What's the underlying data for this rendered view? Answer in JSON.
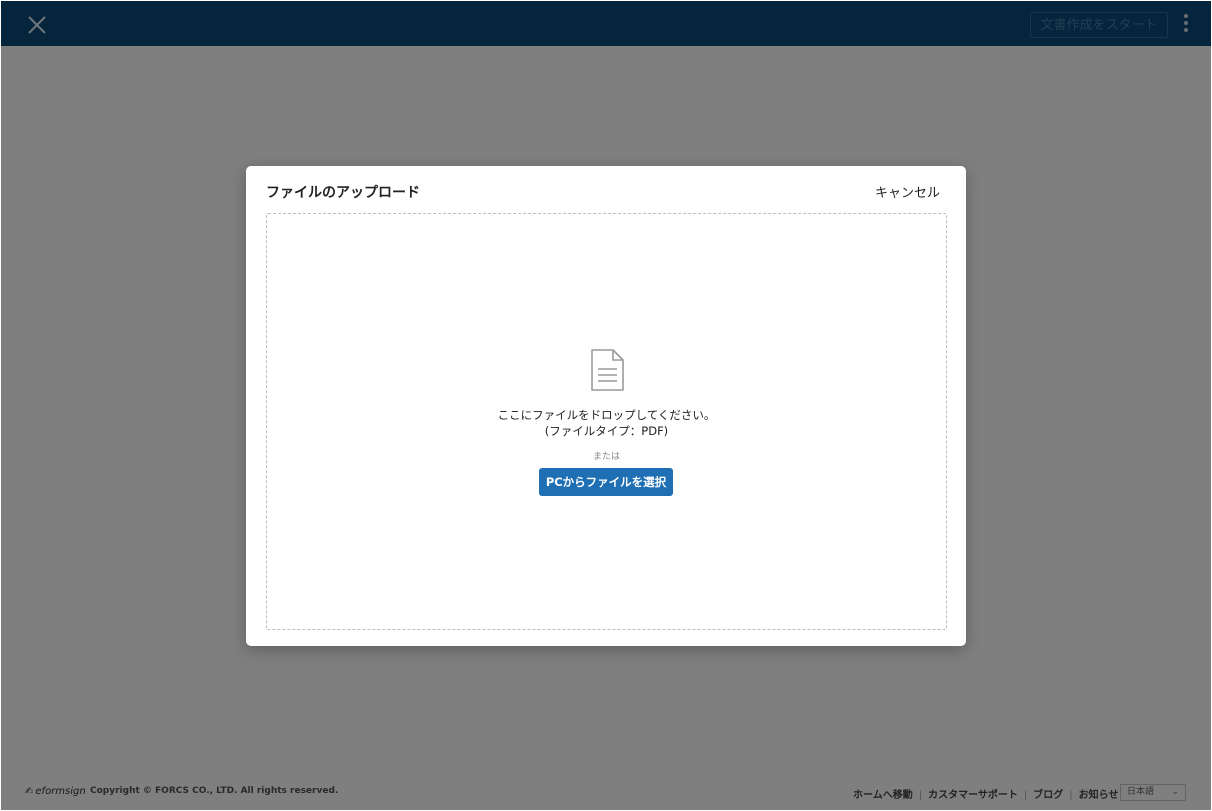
{
  "topbar": {
    "close_icon": "close-icon",
    "start_button_label": "文書作成をスタート",
    "more_icon": "kebab-menu-icon",
    "bg_color": "#0a4a78"
  },
  "footer": {
    "brand_name": "eformsign",
    "copyright": "Copyright © FORCS CO., LTD. All rights reserved.",
    "links": [
      "ホームへ移動",
      "カスタマーサポート",
      "ブログ",
      "お知らせ"
    ],
    "language_selected": "日本語"
  },
  "modal": {
    "title": "ファイルのアップロード",
    "cancel_label": "キャンセル",
    "drop_instruction": "ここにファイルをドロップしてください。",
    "file_type_note": "(ファイルタイプ：PDF)",
    "or_label": "または",
    "select_button_label": "PCからファイルを選択",
    "accent_color": "#1f6fb5",
    "document_icon": "document-icon"
  }
}
